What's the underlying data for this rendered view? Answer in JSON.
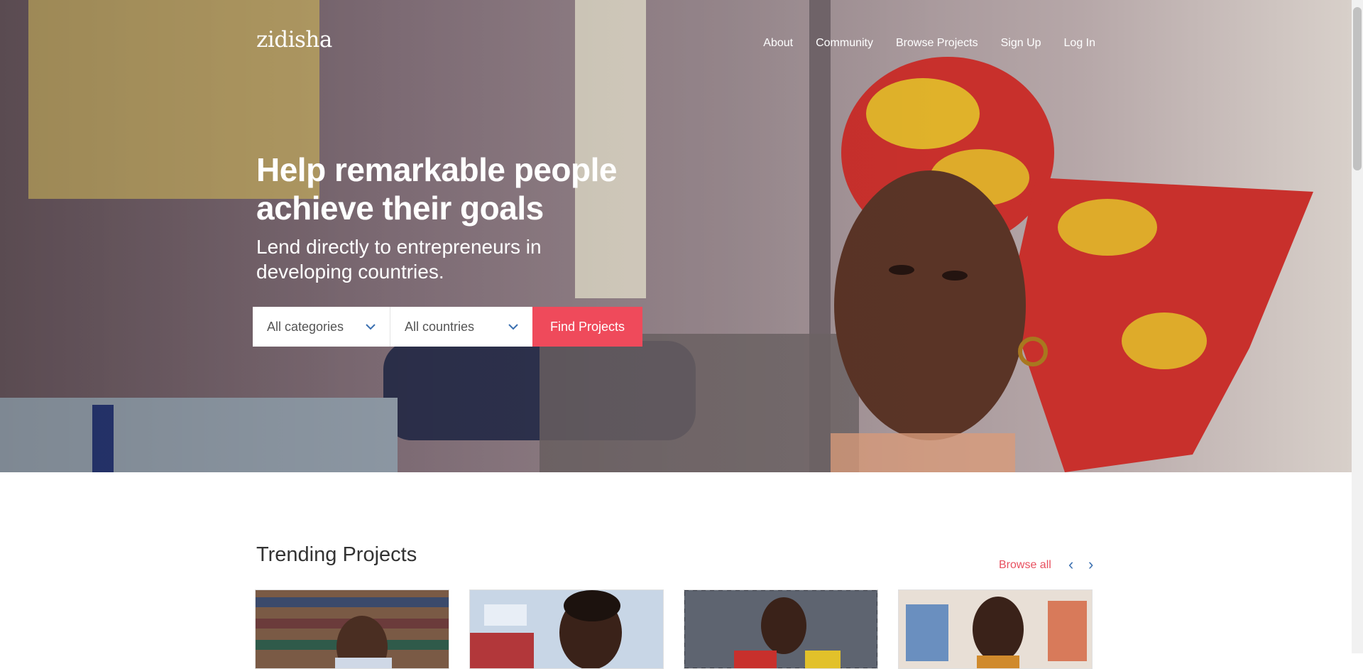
{
  "brand": {
    "logo": "zidisha"
  },
  "nav": {
    "items": [
      "About",
      "Community",
      "Browse Projects",
      "Sign Up",
      "Log In"
    ]
  },
  "hero": {
    "title": "Help remarkable people achieve their goals",
    "subtitle": "Lend directly to entrepreneurs in developing countries."
  },
  "search": {
    "category_selected": "All categories",
    "country_selected": "All countries",
    "button_label": "Find Projects"
  },
  "trending": {
    "heading": "Trending Projects",
    "browse_all": "Browse all"
  },
  "colors": {
    "accent": "#ef4a5b",
    "link": "#e8505f",
    "arrow": "#3a6fb0"
  }
}
